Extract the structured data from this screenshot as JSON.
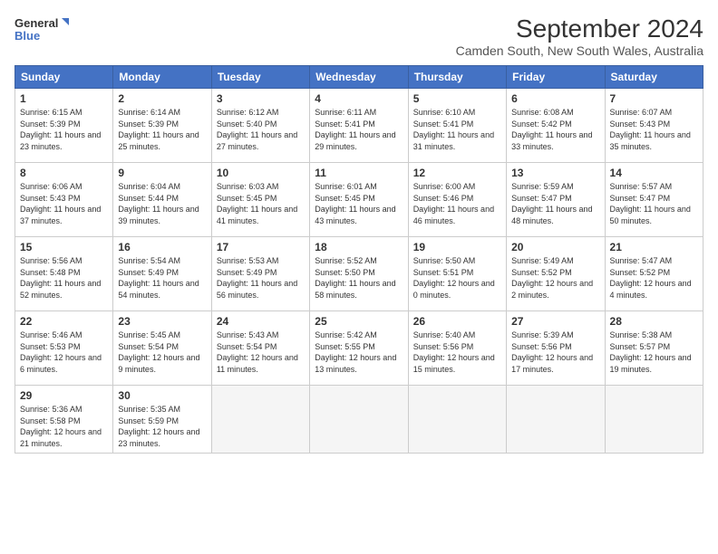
{
  "header": {
    "logo_line1": "General",
    "logo_line2": "Blue",
    "month_title": "September 2024",
    "location": "Camden South, New South Wales, Australia"
  },
  "weekdays": [
    "Sunday",
    "Monday",
    "Tuesday",
    "Wednesday",
    "Thursday",
    "Friday",
    "Saturday"
  ],
  "days": [
    {
      "num": "",
      "sunrise": "",
      "sunset": "",
      "daylight": "",
      "empty": true
    },
    {
      "num": "1",
      "sunrise": "Sunrise: 6:15 AM",
      "sunset": "Sunset: 5:39 PM",
      "daylight": "Daylight: 11 hours and 23 minutes."
    },
    {
      "num": "2",
      "sunrise": "Sunrise: 6:14 AM",
      "sunset": "Sunset: 5:39 PM",
      "daylight": "Daylight: 11 hours and 25 minutes."
    },
    {
      "num": "3",
      "sunrise": "Sunrise: 6:12 AM",
      "sunset": "Sunset: 5:40 PM",
      "daylight": "Daylight: 11 hours and 27 minutes."
    },
    {
      "num": "4",
      "sunrise": "Sunrise: 6:11 AM",
      "sunset": "Sunset: 5:41 PM",
      "daylight": "Daylight: 11 hours and 29 minutes."
    },
    {
      "num": "5",
      "sunrise": "Sunrise: 6:10 AM",
      "sunset": "Sunset: 5:41 PM",
      "daylight": "Daylight: 11 hours and 31 minutes."
    },
    {
      "num": "6",
      "sunrise": "Sunrise: 6:08 AM",
      "sunset": "Sunset: 5:42 PM",
      "daylight": "Daylight: 11 hours and 33 minutes."
    },
    {
      "num": "7",
      "sunrise": "Sunrise: 6:07 AM",
      "sunset": "Sunset: 5:43 PM",
      "daylight": "Daylight: 11 hours and 35 minutes."
    },
    {
      "num": "8",
      "sunrise": "Sunrise: 6:06 AM",
      "sunset": "Sunset: 5:43 PM",
      "daylight": "Daylight: 11 hours and 37 minutes."
    },
    {
      "num": "9",
      "sunrise": "Sunrise: 6:04 AM",
      "sunset": "Sunset: 5:44 PM",
      "daylight": "Daylight: 11 hours and 39 minutes."
    },
    {
      "num": "10",
      "sunrise": "Sunrise: 6:03 AM",
      "sunset": "Sunset: 5:45 PM",
      "daylight": "Daylight: 11 hours and 41 minutes."
    },
    {
      "num": "11",
      "sunrise": "Sunrise: 6:01 AM",
      "sunset": "Sunset: 5:45 PM",
      "daylight": "Daylight: 11 hours and 43 minutes."
    },
    {
      "num": "12",
      "sunrise": "Sunrise: 6:00 AM",
      "sunset": "Sunset: 5:46 PM",
      "daylight": "Daylight: 11 hours and 46 minutes."
    },
    {
      "num": "13",
      "sunrise": "Sunrise: 5:59 AM",
      "sunset": "Sunset: 5:47 PM",
      "daylight": "Daylight: 11 hours and 48 minutes."
    },
    {
      "num": "14",
      "sunrise": "Sunrise: 5:57 AM",
      "sunset": "Sunset: 5:47 PM",
      "daylight": "Daylight: 11 hours and 50 minutes."
    },
    {
      "num": "15",
      "sunrise": "Sunrise: 5:56 AM",
      "sunset": "Sunset: 5:48 PM",
      "daylight": "Daylight: 11 hours and 52 minutes."
    },
    {
      "num": "16",
      "sunrise": "Sunrise: 5:54 AM",
      "sunset": "Sunset: 5:49 PM",
      "daylight": "Daylight: 11 hours and 54 minutes."
    },
    {
      "num": "17",
      "sunrise": "Sunrise: 5:53 AM",
      "sunset": "Sunset: 5:49 PM",
      "daylight": "Daylight: 11 hours and 56 minutes."
    },
    {
      "num": "18",
      "sunrise": "Sunrise: 5:52 AM",
      "sunset": "Sunset: 5:50 PM",
      "daylight": "Daylight: 11 hours and 58 minutes."
    },
    {
      "num": "19",
      "sunrise": "Sunrise: 5:50 AM",
      "sunset": "Sunset: 5:51 PM",
      "daylight": "Daylight: 12 hours and 0 minutes."
    },
    {
      "num": "20",
      "sunrise": "Sunrise: 5:49 AM",
      "sunset": "Sunset: 5:52 PM",
      "daylight": "Daylight: 12 hours and 2 minutes."
    },
    {
      "num": "21",
      "sunrise": "Sunrise: 5:47 AM",
      "sunset": "Sunset: 5:52 PM",
      "daylight": "Daylight: 12 hours and 4 minutes."
    },
    {
      "num": "22",
      "sunrise": "Sunrise: 5:46 AM",
      "sunset": "Sunset: 5:53 PM",
      "daylight": "Daylight: 12 hours and 6 minutes."
    },
    {
      "num": "23",
      "sunrise": "Sunrise: 5:45 AM",
      "sunset": "Sunset: 5:54 PM",
      "daylight": "Daylight: 12 hours and 9 minutes."
    },
    {
      "num": "24",
      "sunrise": "Sunrise: 5:43 AM",
      "sunset": "Sunset: 5:54 PM",
      "daylight": "Daylight: 12 hours and 11 minutes."
    },
    {
      "num": "25",
      "sunrise": "Sunrise: 5:42 AM",
      "sunset": "Sunset: 5:55 PM",
      "daylight": "Daylight: 12 hours and 13 minutes."
    },
    {
      "num": "26",
      "sunrise": "Sunrise: 5:40 AM",
      "sunset": "Sunset: 5:56 PM",
      "daylight": "Daylight: 12 hours and 15 minutes."
    },
    {
      "num": "27",
      "sunrise": "Sunrise: 5:39 AM",
      "sunset": "Sunset: 5:56 PM",
      "daylight": "Daylight: 12 hours and 17 minutes."
    },
    {
      "num": "28",
      "sunrise": "Sunrise: 5:38 AM",
      "sunset": "Sunset: 5:57 PM",
      "daylight": "Daylight: 12 hours and 19 minutes."
    },
    {
      "num": "29",
      "sunrise": "Sunrise: 5:36 AM",
      "sunset": "Sunset: 5:58 PM",
      "daylight": "Daylight: 12 hours and 21 minutes."
    },
    {
      "num": "30",
      "sunrise": "Sunrise: 5:35 AM",
      "sunset": "Sunset: 5:59 PM",
      "daylight": "Daylight: 12 hours and 23 minutes."
    },
    {
      "num": "",
      "sunrise": "",
      "sunset": "",
      "daylight": "",
      "empty": true
    },
    {
      "num": "",
      "sunrise": "",
      "sunset": "",
      "daylight": "",
      "empty": true
    },
    {
      "num": "",
      "sunrise": "",
      "sunset": "",
      "daylight": "",
      "empty": true
    },
    {
      "num": "",
      "sunrise": "",
      "sunset": "",
      "daylight": "",
      "empty": true
    },
    {
      "num": "",
      "sunrise": "",
      "sunset": "",
      "daylight": "",
      "empty": true
    }
  ]
}
